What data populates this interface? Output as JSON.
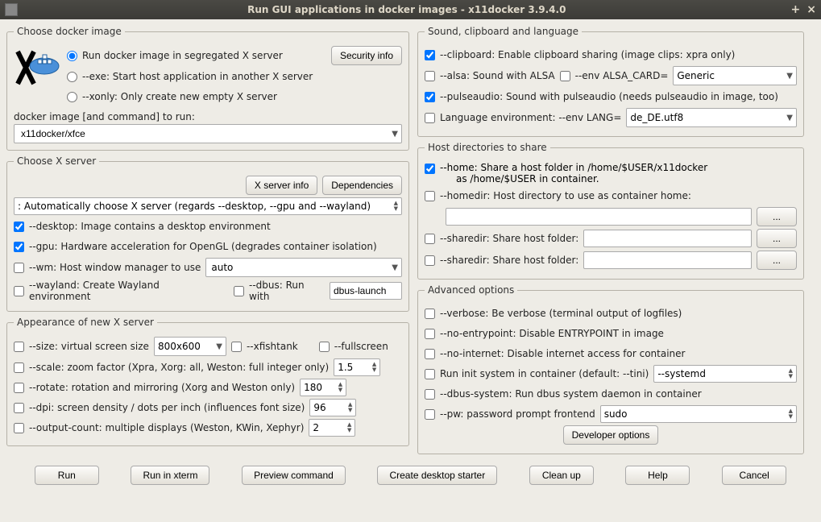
{
  "window": {
    "title": "Run GUI applications in docker images - x11docker 3.9.4.0",
    "min_btn": "+",
    "close_btn": "×"
  },
  "choose_image": {
    "legend": "Choose docker image",
    "radio_seg": "Run docker image in segregated X server",
    "radio_exe": "--exe: Start host application in another X server",
    "radio_xonly": "--xonly: Only create new empty X server",
    "sec_info_btn": "Security info",
    "cmd_label": "docker image [and command] to run:",
    "cmd_value": "x11docker/xfce"
  },
  "xserver": {
    "legend": "Choose X server",
    "info_btn": "X server info",
    "deps_btn": "Dependencies",
    "auto_select": ": Automatically choose X server (regards --desktop, --gpu and --wayland)",
    "desktop": "--desktop: Image contains a desktop environment",
    "gpu": "--gpu: Hardware acceleration for OpenGL (degrades container isolation)",
    "wm": "--wm: Host window manager to use",
    "wm_value": "auto",
    "wayland": "--wayland: Create Wayland environment",
    "dbus": "--dbus: Run with",
    "dbus_value": "dbus-launch"
  },
  "appearance": {
    "legend": "Appearance of new X server",
    "size": "--size: virtual screen size",
    "size_value": "800x600",
    "xfishtank": "--xfishtank",
    "fullscreen": "--fullscreen",
    "scale": "--scale: zoom factor (Xpra, Xorg: all, Weston: full integer only)",
    "scale_value": "1.5",
    "rotate": "--rotate: rotation and mirroring (Xorg and Weston only)",
    "rotate_value": "180",
    "dpi": "--dpi: screen density / dots per inch (influences font size)",
    "dpi_value": "96",
    "output_count": "--output-count: multiple displays (Weston, KWin, Xephyr)",
    "output_count_value": "2"
  },
  "sound": {
    "legend": "Sound, clipboard and language",
    "clipboard": "--clipboard: Enable clipboard sharing (image clips: xpra only)",
    "alsa": "--alsa: Sound with ALSA",
    "alsa_card": "--env ALSA_CARD=",
    "alsa_value": "Generic",
    "pulse": "--pulseaudio: Sound with pulseaudio (needs pulseaudio in image, too)",
    "lang": "Language environment:  --env LANG=",
    "lang_value": "de_DE.utf8"
  },
  "hostdirs": {
    "legend": "Host directories to share",
    "home_line1": "--home: Share a host folder in /home/$USER/x11docker",
    "home_line2": "as /home/$USER in container.",
    "homedir": "--homedir: Host directory to use as container home:",
    "sharedir1": "--sharedir: Share host folder:",
    "sharedir2": "--sharedir: Share host folder:",
    "browse": "..."
  },
  "advanced": {
    "legend": "Advanced options",
    "verbose": "--verbose: Be verbose (terminal output of logfiles)",
    "noentry": "--no-entrypoint: Disable ENTRYPOINT in image",
    "nointernet": "--no-internet: Disable internet access for container",
    "init": "Run init system in container (default: --tini)",
    "init_value": "--systemd",
    "dbussys": "--dbus-system: Run dbus system daemon in container",
    "pw": "--pw: password prompt frontend",
    "pw_value": "sudo",
    "dev_btn": "Developer options"
  },
  "buttons": {
    "run": "Run",
    "run_xterm": "Run in xterm",
    "preview": "Preview command",
    "create_starter": "Create desktop starter",
    "cleanup": "Clean up",
    "help": "Help",
    "cancel": "Cancel"
  }
}
